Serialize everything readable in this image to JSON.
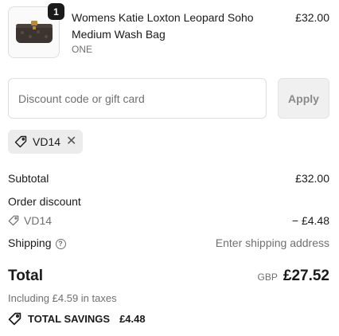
{
  "cart": {
    "item": {
      "quantity": "1",
      "title": "Womens Katie Loxton Leopard Soho Medium Wash Bag",
      "variant": "ONE",
      "price": "£32.00"
    }
  },
  "discount": {
    "placeholder": "Discount code or gift card",
    "apply_label": "Apply",
    "applied_code": "VD14",
    "remove_symbol": "✕"
  },
  "summary": {
    "subtotal_label": "Subtotal",
    "subtotal_value": "£32.00",
    "order_discount_label": "Order discount",
    "discount_code": "VD14",
    "discount_value": "− £4.48",
    "shipping_label": "Shipping",
    "shipping_value": "Enter shipping address",
    "total_label": "Total",
    "currency": "GBP",
    "total_value": "£27.52",
    "taxes_note": "Including £4.59 in taxes",
    "savings_label": "TOTAL SAVINGS",
    "savings_value": "£4.48"
  },
  "icons": {
    "tag": "tag-icon",
    "help": "question-circle-icon",
    "close": "close-icon"
  },
  "colors": {
    "text": "#1a1a1a",
    "muted": "#707070",
    "chip_bg": "#ececec",
    "button_bg": "#f0f0f0"
  }
}
